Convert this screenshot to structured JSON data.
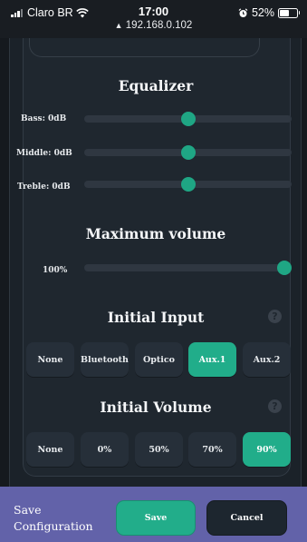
{
  "status_bar": {
    "carrier": "Claro BR",
    "time": "17:00",
    "url": "192.168.0.102",
    "battery": "52%",
    "battery_level": 0.52
  },
  "equalizer": {
    "title": "Equalizer",
    "sliders": [
      {
        "label": "Bass: 0dB",
        "level": 0.5
      },
      {
        "label": "Middle: 0dB",
        "level": 0.5
      },
      {
        "label": "Treble: 0dB",
        "level": 0.5
      }
    ]
  },
  "max_volume": {
    "title": "Maximum volume",
    "label": "100%",
    "level": 1.0
  },
  "initial_input": {
    "title": "Initial Input",
    "help_icon": "question-icon",
    "options": [
      "None",
      "Bluetooth",
      "Optico",
      "Aux.1",
      "Aux.2"
    ],
    "selected": "Aux.1"
  },
  "initial_volume": {
    "title": "Initial Volume",
    "help_icon": "question-icon",
    "options": [
      "None",
      "0%",
      "50%",
      "70%",
      "90%"
    ],
    "selected": "90%"
  },
  "footer": {
    "label_line1": "Save",
    "label_line2": "Configuration",
    "save_label": "Save",
    "cancel_label": "Cancel"
  },
  "colors": {
    "accent": "#21ad8a",
    "footer_bg": "#6262a9",
    "panel_bg": "#1f272f"
  }
}
